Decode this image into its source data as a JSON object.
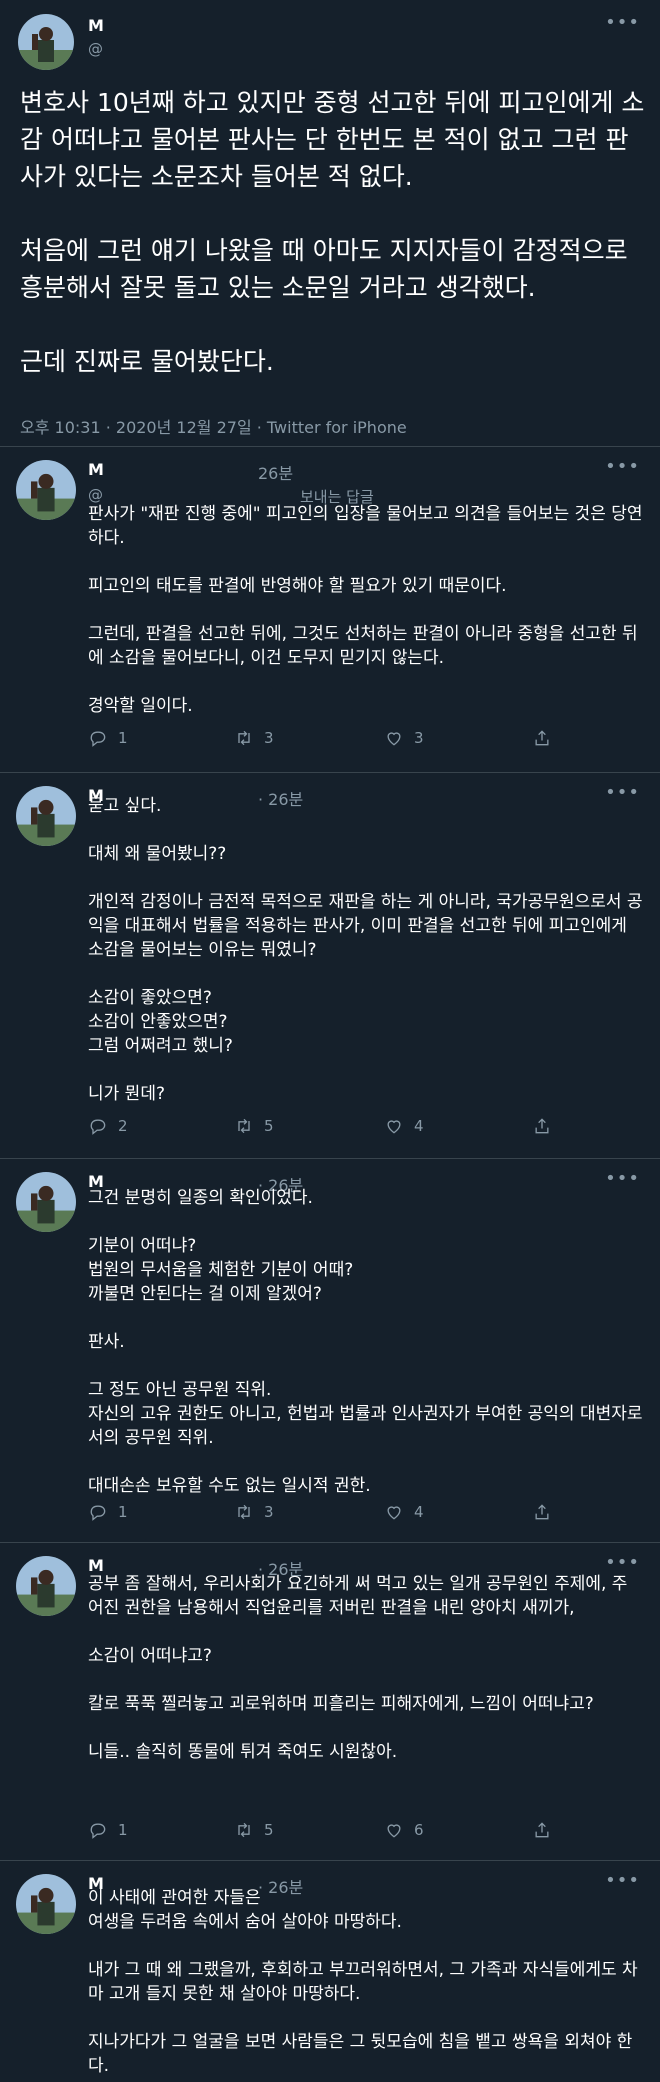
{
  "main_tweet": {
    "name": "M",
    "handle": "@",
    "text": "변호사 10년째 하고 있지만 중형 선고한 뒤에 피고인에게 소감 어떠냐고 물어본 판사는 단 한번도 본 적이 없고 그런 판사가 있다는 소문조차 들어본 적 없다.\n\n처음에 그런 얘기 나왔을 때 아마도 지지자들이 감정적으로 흥분해서 잘못 돌고 있는 소문일 거라고 생각했다.\n\n근데 진짜로 물어봤단다.",
    "meta": "오후 10:31 · 2020년 12월 27일 · Twitter for iPhone"
  },
  "replies": [
    {
      "name": "M",
      "handle": "@",
      "time": "26분",
      "replying": "보내는 답글",
      "text": "판사가 \"재판 진행 중에\" 피고인의 입장을 물어보고 의견을 들어보는 것은 당연하다.\n\n피고인의 태도를 판결에 반영해야 할 필요가 있기 때문이다.\n\n그런데, 판결을 선고한 뒤에, 그것도 선처하는 판결이 아니라 중형을 선고한 뒤에 소감을 물어보다니, 이건 도무지 믿기지 않는다.\n\n경악할 일이다.",
      "replies": "1",
      "retweets": "3",
      "likes": "3"
    },
    {
      "name": "M",
      "time": "· 26분",
      "text": "묻고 싶다.\n\n대체 왜 물어봤니??\n\n개인적 감정이나 금전적 목적으로 재판을 하는 게 아니라, 국가공무원으로서 공익을 대표해서 법률을 적용하는 판사가, 이미 판결을 선고한 뒤에 피고인에게 소감을 물어보는 이유는 뭐였니?\n\n소감이 좋았으면?\n소감이 안좋았으면?\n그럼 어쩌려고 했니?\n\n니가 뭔데?",
      "replies": "2",
      "retweets": "5",
      "likes": "4"
    },
    {
      "name": "M",
      "time": "· 26분",
      "text": "그건 분명히 일종의 확인이었다.\n\n기분이 어떠냐?\n법원의 무서움을 체험한 기분이 어때?\n까불면 안된다는 걸 이제 알겠어?\n\n판사.\n\n그 정도 아닌 공무원 직위.\n자신의 고유 권한도 아니고, 헌법과 법률과 인사권자가 부여한 공익의 대변자로서의 공무원 직위.\n\n대대손손 보유할 수도 없는 일시적 권한.",
      "replies": "1",
      "retweets": "3",
      "likes": "4"
    },
    {
      "name": "M",
      "time": "· 26분",
      "text": "공부 좀 잘해서, 우리사회가 요긴하게 써 먹고 있는 일개 공무원인 주제에, 주어진 권한을 남용해서 직업윤리를 저버린 판결을 내린 양아치 새끼가,\n\n소감이 어떠냐고?\n\n칼로 푹푹 찔러놓고 괴로워하며 피흘리는 피해자에게, 느낌이 어떠냐고?\n\n니들.. 솔직히 똥물에 튀겨 죽여도 시원찮아.",
      "replies": "1",
      "retweets": "5",
      "likes": "6"
    },
    {
      "name": "M",
      "time": "· 26분",
      "text": "이 사태에 관여한 자들은\n여생을 두려움 속에서 숨어 살아야 마땅하다.\n\n내가 그 때 왜 그랬을까, 후회하고 부끄러워하면서, 그 가족과 자식들에게도 차마 고개 들지 못한 채 살아야 마땅하다.\n\n지나가다가 그 얼굴을 보면 사람들은 그 뒷모습에 침을 뱉고 쌍욕을 외쳐야 한다."
    }
  ],
  "colors": {
    "background": "#15202b",
    "text": "#ffffff",
    "muted": "#8899a6",
    "divider": "#38444d"
  },
  "icons": {
    "reply": "reply-icon",
    "retweet": "retweet-icon",
    "like": "like-icon",
    "share": "share-icon",
    "more": "more-icon"
  }
}
